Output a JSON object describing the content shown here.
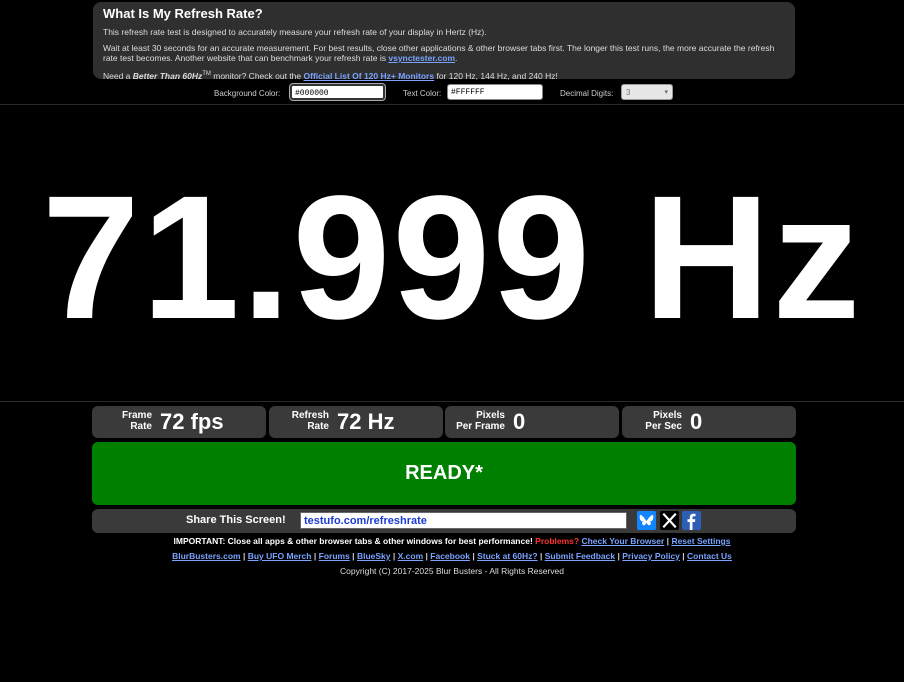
{
  "info": {
    "title": "What Is My Refresh Rate?",
    "p1": "This refresh rate test is designed to accurately measure your refresh rate of your display in Hertz (Hz).",
    "p2": "Wait at least 30 seconds for an accurate measurement. For best results, close other applications & other browser tabs first. The longer this test runs, the more accurate the refresh rate test becomes. Another website that can benchmark your refresh rate is ",
    "p2_link": "vsynctester.com",
    "p3_a": "Need a ",
    "p3_em": "Better Than 60Hz",
    "p3_tm": "TM",
    "p3_b": " monitor? Check out the ",
    "p3_link": "Official List Of 120 Hz+ Monitors",
    "p3_c": " for 120 Hz, 144 Hz, and 240 Hz!"
  },
  "settings": {
    "bg_label": "Background Color:",
    "bg_value": "#000000",
    "text_label": "Text Color:",
    "text_value": "#FFFFFF",
    "digits_label": "Decimal Digits:",
    "digits_value": "3"
  },
  "rate_display": "71.999 Hz",
  "stats": [
    {
      "label_1": "Frame",
      "label_2": "Rate",
      "value": "72 fps"
    },
    {
      "label_1": "Refresh",
      "label_2": "Rate",
      "value": "72 Hz"
    },
    {
      "label_1": "Pixels",
      "label_2": "Per Frame",
      "value": "0"
    },
    {
      "label_1": "Pixels",
      "label_2": "Per Sec",
      "value": "0"
    }
  ],
  "status": "READY*",
  "share": {
    "label": "Share This Screen!",
    "url": "testufo.com/refreshrate"
  },
  "footer": {
    "important": "IMPORTANT: Close all apps & other browser tabs & other windows for best performance!",
    "problems": "Problems?",
    "check_browser": "Check Your Browser",
    "reset": "Reset Settings",
    "links": [
      "BlurBusters.com",
      "Buy UFO Merch",
      "Forums",
      "BlueSky",
      "X.com",
      "Facebook",
      "Stuck at 60Hz?",
      "Submit Feedback",
      "Privacy Policy",
      "Contact Us"
    ],
    "copyright": "Copyright (C) 2017-2025 Blur Busters - All Rights Reserved"
  },
  "colors": {
    "ready_green": "#008000",
    "link_blue": "#7aa3ff",
    "problems_red": "#ff3333"
  }
}
